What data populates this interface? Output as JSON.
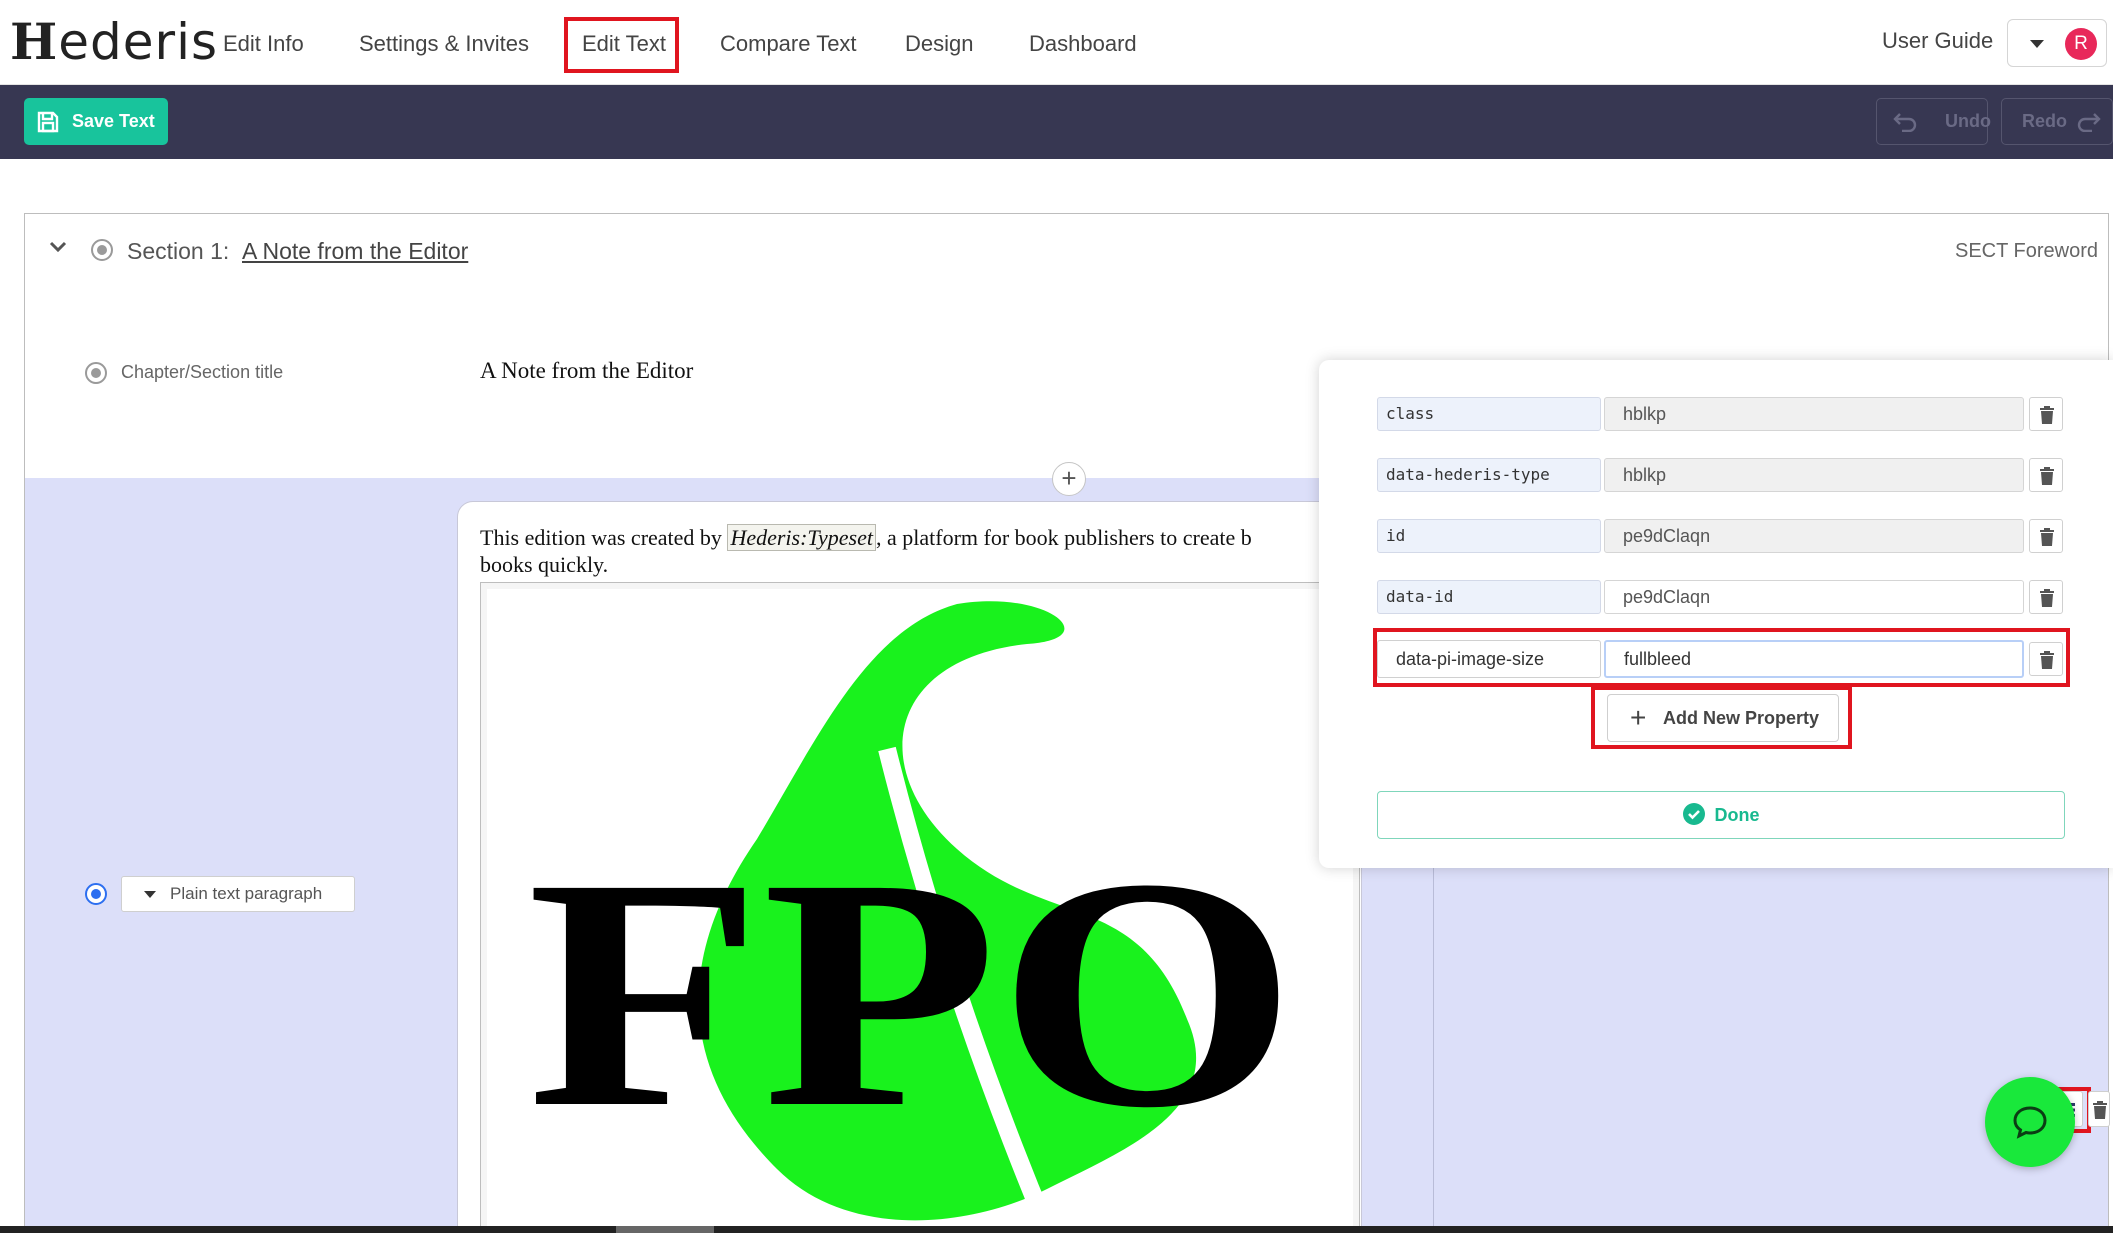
{
  "app": {
    "logo_text": "ederis",
    "logo_letter": "H"
  },
  "nav": {
    "items": [
      {
        "label": "Edit Info"
      },
      {
        "label": "Settings & Invites"
      },
      {
        "label": "Edit Text"
      },
      {
        "label": "Compare Text"
      },
      {
        "label": "Design"
      },
      {
        "label": "Dashboard"
      }
    ],
    "active": "Edit Text",
    "user_guide": "User Guide",
    "avatar_initial": "R"
  },
  "toolbar": {
    "save_label": "Save Text",
    "undo_label": "Undo",
    "redo_label": "Redo"
  },
  "section": {
    "label": "Section 1:",
    "title": "A Note from the Editor",
    "tag": "SECT Foreword",
    "title_row_label": "Chapter/Section title",
    "title_row_value": "A Note from the Editor"
  },
  "paragraph": {
    "type": "Plain text paragraph",
    "text_before": "This edition was created by ",
    "text_link": "Hederis:Typeset",
    "text_after": ", a platform for book publishers to create b",
    "text_line2": "books quickly.",
    "image_text": "FPO"
  },
  "properties": {
    "rows": [
      {
        "key": "class",
        "value": "hblkp"
      },
      {
        "key": "data-hederis-type",
        "value": "hblkp"
      },
      {
        "key": "id",
        "value": "pe9dClaqn"
      },
      {
        "key": "data-id",
        "value": "pe9dClaqn"
      },
      {
        "key": "data-pi-image-size",
        "value": "fullbleed"
      }
    ],
    "add_label": "Add New Property",
    "done_label": "Done"
  },
  "icons": {
    "save": "floppy-disk-icon",
    "undo": "undo-arrow-icon",
    "redo": "redo-arrow-icon",
    "collapse": "chevron-down-icon",
    "insert": "plus-icon",
    "properties": "list-icon",
    "delete": "trash-icon",
    "done": "check-circle-icon",
    "chat": "chat-bubble-icon"
  },
  "colors": {
    "accent": "#18c49c",
    "toolbar": "#373752",
    "highlight": "#e0151f",
    "leaf_green": "#19f21d",
    "block_bg": "#dcdff9",
    "chat": "#19e83b",
    "avatar": "#e8285a"
  }
}
